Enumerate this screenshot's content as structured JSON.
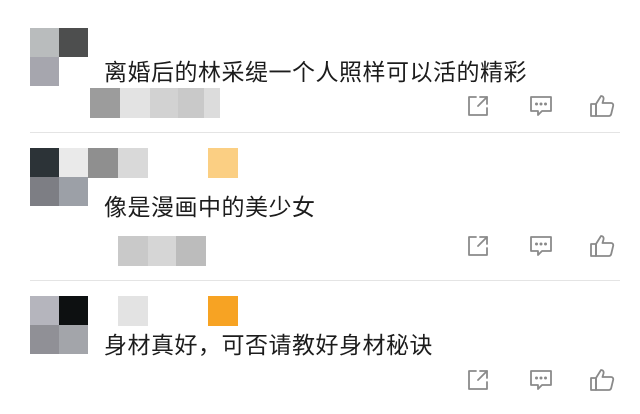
{
  "comments": [
    {
      "text": "离婚后的林采缇一个人照样可以活的精彩",
      "avatar_colors": [
        "#b9bcbd",
        "#4d4e4e",
        "#a6a6ae",
        "#ffffff"
      ],
      "name_blur_colors": [],
      "meta_blur_colors": [
        "#9c9c9c",
        "#e3e3e3",
        "#d2d2d2",
        "#c9c9c9",
        "#dcdcdc"
      ],
      "actions": {
        "share_icon": "share-icon",
        "reply_icon": "comment-icon",
        "like_icon": "thumbs-up-icon"
      }
    },
    {
      "text": "像是漫画中的美少女",
      "avatar_colors": [
        "#2c3337",
        "#eaeaea",
        "#7d7e84",
        "#9ca0a7"
      ],
      "name_blur_colors": [
        "#8f8f8f",
        "#d9d9d9",
        "#ffffff",
        "#fbcf83"
      ],
      "meta_blur_colors": [
        "#c9c9c9",
        "#d6d6d6",
        "#bcbcbc"
      ],
      "actions": {
        "share_icon": "share-icon",
        "reply_icon": "comment-icon",
        "like_icon": "thumbs-up-icon"
      }
    },
    {
      "text": "身材真好，可否请教好身材秘诀",
      "avatar_colors": [
        "#b5b5bd",
        "#0d1011",
        "#909096",
        "#a3a5aa"
      ],
      "name_blur_colors": [
        "#ffffff",
        "#e3e3e3",
        "#ffffff",
        "#f7a323"
      ],
      "meta_blur_colors": [],
      "actions": {
        "share_icon": "share-icon",
        "reply_icon": "comment-icon",
        "like_icon": "thumbs-up-icon"
      }
    }
  ],
  "icon_color": "#8a8a8a"
}
